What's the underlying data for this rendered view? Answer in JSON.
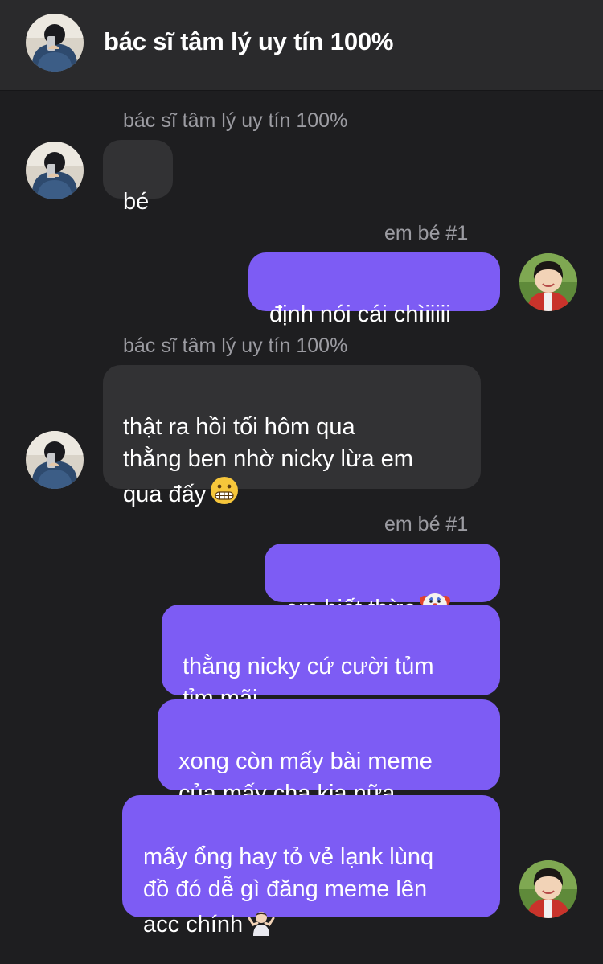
{
  "header": {
    "title": "bác sĩ tâm lý uy tín 100%"
  },
  "messages": [
    {
      "sender": "bác sĩ tâm lý uy tín 100%",
      "text": "bé"
    },
    {
      "sender": "em bé #1",
      "text": "định nói cái chìiiiii"
    },
    {
      "sender": "bác sĩ tâm lý uy tín 100%",
      "text": "thật ra hồi tối hôm qua\nthằng ben nhờ nicky lừa em\nqua đấy",
      "emoji": "grimacing-face"
    },
    {
      "sender": "em bé #1",
      "text": "em biết thừa",
      "emoji": "clown-face"
    },
    {
      "text": "thằng nicky cứ cười tủm\ntỉm mãi"
    },
    {
      "text": "xong còn mấy bài meme\ncủa mấy cha kia nữa"
    },
    {
      "text": "mấy ổng hay tỏ vẻ lạnk lùnq\nđồ đó dễ gì đăng meme lên\nacc chính",
      "emoji": "person-shrugging"
    }
  ],
  "colors": {
    "background": "#1e1e20",
    "header": "#2a2a2c",
    "incoming_bubble": "#323234",
    "outgoing_bubble": "#7d5cf4",
    "sender_label": "#9c9ca2"
  }
}
